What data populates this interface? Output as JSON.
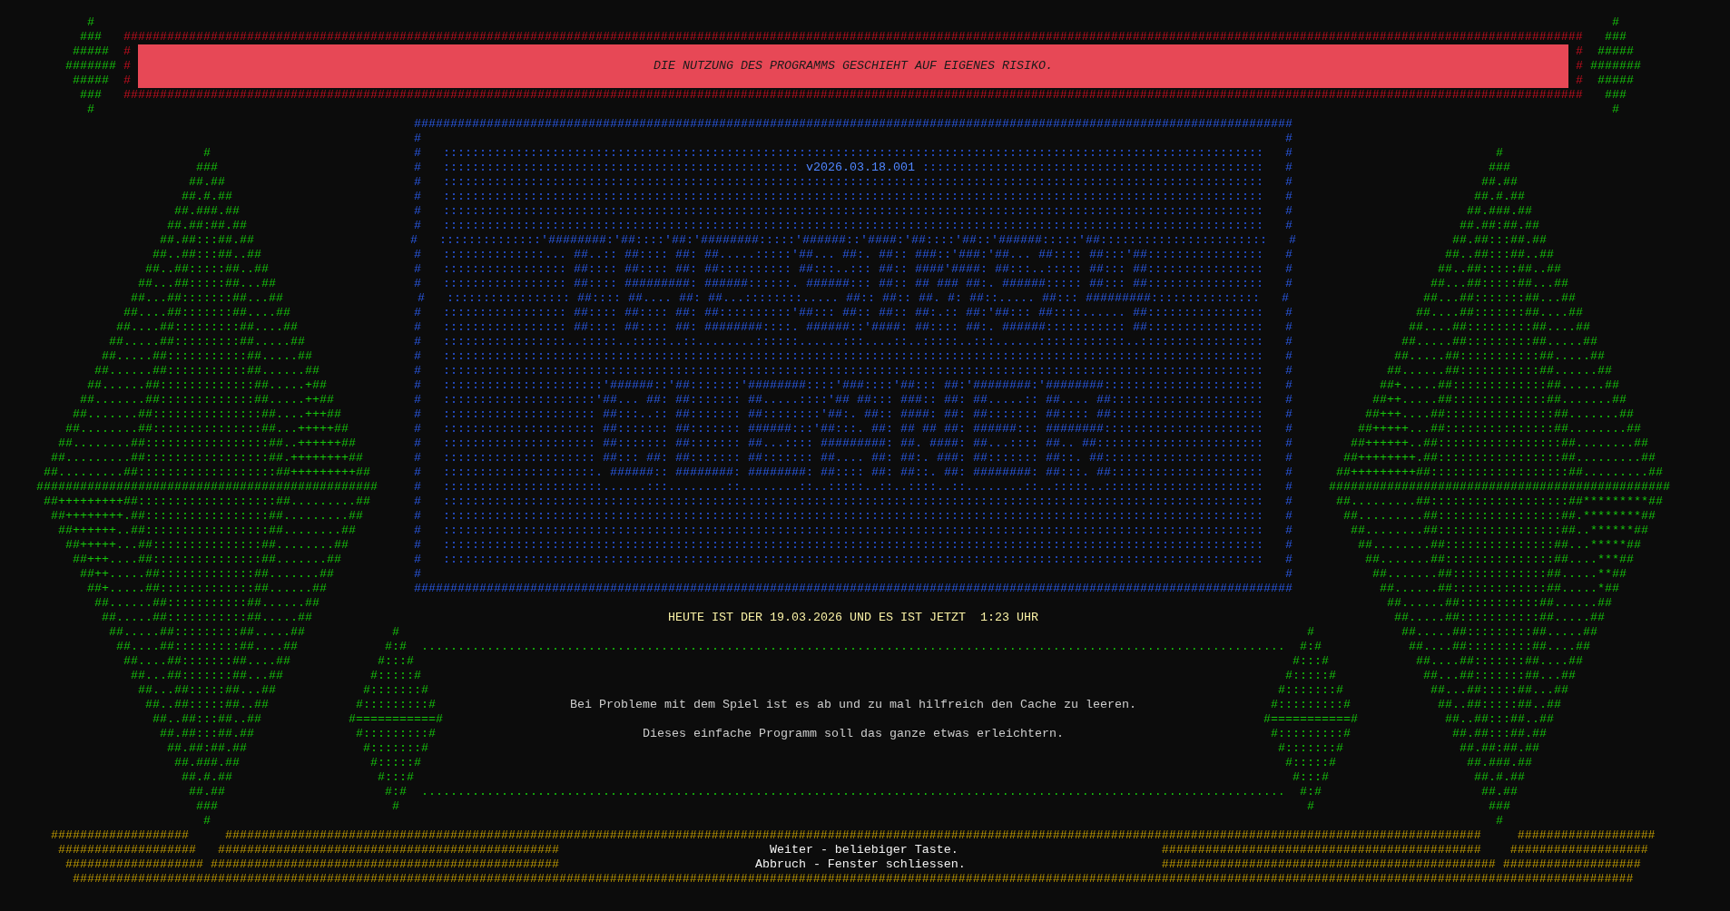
{
  "top_left_diamond": [
    "#",
    "###",
    "#####",
    "#######",
    "#####",
    "###",
    "#"
  ],
  "warning_banner": {
    "top_border": "#########################################################################################################################################################################################################",
    "left_marks": [
      "#",
      "#",
      "#"
    ],
    "message": "DIE NUTZUNG DES PROGRAMMS GESCHIEHT AUF EIGENES RISIKO.",
    "right_marks": [
      "#",
      "#",
      "#"
    ],
    "bottom_border": "#########################################################################################################################################################################################################"
  },
  "top_right_diamond": [
    "#",
    "###",
    "#####",
    "#######",
    "#####",
    "###",
    "#"
  ],
  "left_diamond": [
    "#",
    "###",
    "##.##",
    "##.#.##",
    "##.###.##",
    "##.##:##.##",
    "##.##:::##.##",
    "##..##:::##..##",
    "##..##:::::##..##",
    "##...##:::::##...##",
    "##...##:::::::##...##",
    "##....##:::::::##....##",
    "##....##:::::::::##....##",
    "##.....##:::::::::##.....##",
    "##.....##:::::::::::##.....##",
    "##......##:::::::::::##......##",
    "##......##:::::::::::::##.....+##",
    "##.......##:::::::::::::##.....++##",
    "##.......##:::::::::::::::##....+++##",
    "##........##:::::::::::::::##...+++++##",
    "##........##:::::::::::::::::##..++++++##",
    "##.........##:::::::::::::::::##.++++++++##",
    "##.........##:::::::::::::::::::##+++++++++##",
    "###############################################",
    "##+++++++++##:::::::::::::::::::##.........##",
    "##++++++++.##:::::::::::::::::##.........##",
    "##++++++..##:::::::::::::::::##........##",
    "##+++++...##:::::::::::::::##........##",
    "##+++....##:::::::::::::::##.......##",
    "##++.....##:::::::::::::##.......##",
    "##+.....##:::::::::::::##......##",
    "##......##:::::::::::##......##",
    "##.....##:::::::::::##.....##",
    "##.....##:::::::::##.....##",
    "##....##:::::::::##....##",
    "##....##:::::::##....##",
    "##...##:::::::##...##",
    "##...##:::::##...##",
    "##..##:::::##..##",
    "##..##:::##..##",
    "##.##:::##.##",
    "##.##:##.##",
    "##.###.##",
    "##.#.##",
    "##.##",
    "###",
    "#"
  ],
  "title_box": {
    "rows": [
      {
        "kind": "border",
        "text": "#########################################################################################################################"
      },
      {
        "kind": "plain",
        "text": "#                                                                                                                       #"
      },
      {
        "kind": "plain",
        "text": "#   :::::::::::::::::::::::::::::::::::::::::::::::::::::::::::::::::::::::::::::::::::::::::::::::::::::::::::::::::   #"
      },
      {
        "kind": "version",
        "before": "#   ::::::::::::::::::::::::::::::::::::::::::::::::: ",
        "version": "v2026.03.18.001",
        "after": " :::::::::::::::::::::::::::::::::::::::::::::::   #"
      },
      {
        "kind": "plain",
        "text": "#   :::::::::::::::::::::::::::::::::::::::::::::::::::::::::::::::::::::::::::::::::::::::::::::::::::::::::::::::::   #"
      },
      {
        "kind": "plain",
        "text": "#   :::::::::::::::::::::::::::::::::::::::::::::::::::::::::::::::::::::::::::::::::::::::::::::::::::::::::::::::::   #"
      },
      {
        "kind": "plain",
        "text": "#   :::::::::::::::::::::::::::::::::::::::::::::::::::::::::::::::::::::::::::::::::::::::::::::::::::::::::::::::::   #"
      },
      {
        "kind": "plain",
        "text": "#   :::::::::::::::::::::::::::::::::::::::::::::::::::::::::::::::::::::::::::::::::::::::::::::::::::::::::::::::::   #"
      },
      {
        "kind": "plain",
        "text": "#   ::::::::::::::'########:'##::::'##:'########:::::'######::'####:'##::::'##::'######:::::'##:::::::::::::::::::::::   #"
      },
      {
        "kind": "plain",
        "text": "#   ::::::::::::::... ##..:: ##:::: ##: ##.....:::::'##... ##:. ##:: ###::'###:'##... ##:::: ##:::'##::::::::::::::::   #"
      },
      {
        "kind": "plain",
        "text": "#   ::::::::::::::::: ##:::: ##:::: ##: ##:::::::::: ##:::..::: ##:: ####'####: ##:::..::::: ##::: ##::::::::::::::::   #"
      },
      {
        "kind": "plain",
        "text": "#   ::::::::::::::::: ##:::: #########: ######::::::. ######::: ##:: ## ### ##:. ######::::: ##::: ##::::::::::::::::   #"
      },
      {
        "kind": "plain",
        "text": "#   ::::::::::::::::: ##:::: ##.... ##: ##...::::::::..... ##:: ##:: ##. #: ##::..... ##::: #########:::::::::::::::   #"
      },
      {
        "kind": "plain",
        "text": "#   ::::::::::::::::: ##:::: ##:::: ##: ##::::::::::'##::: ##:: ##:: ##:.:: ##:'##::: ##::::...... ##::::::::::::::::   #"
      },
      {
        "kind": "plain",
        "text": "#   ::::::::::::::::: ##:::: ##:::: ##: ########::::. ######::'####: ##:::: ##:. ######::::::::::: ##::::::::::::::::   #"
      },
      {
        "kind": "plain",
        "text": "#   :::::::::::::::::..:::::..:::::..::........::::::......:::....::..:::::..:::......::::::::::::..:::::::::::::::::   #"
      },
      {
        "kind": "plain",
        "text": "#   :::::::::::::::::::::::::::::::::::::::::::::::::::::::::::::::::::::::::::::::::::::::::::::::::::::::::::::::::   #"
      },
      {
        "kind": "plain",
        "text": "#   :::::::::::::::::::::::::::::::::::::::::::::::::::::::::::::::::::::::::::::::::::::::::::::::::::::::::::::::::   #"
      },
      {
        "kind": "plain",
        "text": "#   ::::::::::::::::::::::'######::'##:::::::'########::::'###::::'##::: ##:'########:'########::::::::::::::::::::::   #"
      },
      {
        "kind": "plain",
        "text": "#   :::::::::::::::::::::'##... ##: ##::::::: ##.....::::'## ##::: ###:: ##: ##.....:: ##.... ##:::::::::::::::::::::   #"
      },
      {
        "kind": "plain",
        "text": "#   ::::::::::::::::::::: ##:::..:: ##::::::: ##::::::::'##:. ##:: ####: ##: ##::::::: ##:::: ##:::::::::::::::::::::   #"
      },
      {
        "kind": "plain",
        "text": "#   ::::::::::::::::::::: ##::::::: ##::::::: ######:::'##:::. ##: ## ## ##: ######::: ########::::::::::::::::::::::   #"
      },
      {
        "kind": "plain",
        "text": "#   ::::::::::::::::::::: ##::::::: ##::::::: ##...:::: #########: ##. ####: ##...:::: ##.. ##:::::::::::::::::::::::   #"
      },
      {
        "kind": "plain",
        "text": "#   ::::::::::::::::::::: ##::: ##: ##::::::: ##::::::: ##.... ##: ##:. ###: ##::::::: ##::. ##::::::::::::::::::::::   #"
      },
      {
        "kind": "plain",
        "text": "#   :::::::::::::::::::::. ######:: ########: ########: ##:::: ##: ##::. ##: ########: ##:::. ##:::::::::::::::::::::   #"
      },
      {
        "kind": "plain",
        "text": "#   ::::::::::::::::::::::......:::........::........::..:::::..::..::::..::........::..:::::..::::::::::::::::::::::   #"
      },
      {
        "kind": "plain",
        "text": "#   :::::::::::::::::::::::::::::::::::::::::::::::::::::::::::::::::::::::::::::::::::::::::::::::::::::::::::::::::   #"
      },
      {
        "kind": "plain",
        "text": "#   :::::::::::::::::::::::::::::::::::::::::::::::::::::::::::::::::::::::::::::::::::::::::::::::::::::::::::::::::   #"
      },
      {
        "kind": "plain",
        "text": "#   :::::::::::::::::::::::::::::::::::::::::::::::::::::::::::::::::::::::::::::::::::::::::::::::::::::::::::::::::   #"
      },
      {
        "kind": "plain",
        "text": "#   :::::::::::::::::::::::::::::::::::::::::::::::::::::::::::::::::::::::::::::::::::::::::::::::::::::::::::::::::   #"
      },
      {
        "kind": "plain",
        "text": "#   :::::::::::::::::::::::::::::::::::::::::::::::::::::::::::::::::::::::::::::::::::::::::::::::::::::::::::::::::   #"
      },
      {
        "kind": "plain",
        "text": "#                                                                                                                       #"
      },
      {
        "kind": "border",
        "text": "#########################################################################################################################"
      }
    ]
  },
  "right_diamond": [
    "#",
    "###",
    "##.##",
    "##.#.##",
    "##.###.##",
    "##.##:##.##",
    "##.##:::##.##",
    "##..##:::##..##",
    "##..##:::::##..##",
    "##...##:::::##...##",
    "##...##:::::::##...##",
    "##....##:::::::##....##",
    "##....##:::::::::##....##",
    "##.....##:::::::::##.....##",
    "##.....##:::::::::::##.....##",
    "##......##:::::::::::##......##",
    "##+.....##:::::::::::::##......##",
    "##++.....##:::::::::::::##.......##",
    "##+++....##:::::::::::::::##.......##",
    "##+++++...##:::::::::::::::##........##",
    "##++++++..##:::::::::::::::::##........##",
    "##++++++++.##:::::::::::::::::##.........##",
    "##+++++++++##:::::::::::::::::::##.........##",
    "###############################################",
    "##.........##:::::::::::::::::::##*********##",
    "##.........##:::::::::::::::::##.********##",
    "##........##:::::::::::::::::##..******##",
    "##........##:::::::::::::::##...*****##",
    "##.......##:::::::::::::::##....***##",
    "##.......##:::::::::::::##.....**##",
    "##......##:::::::::::::##.....*##",
    "##......##:::::::::::##......##",
    "##.....##:::::::::::##.....##",
    "##.....##:::::::::##.....##",
    "##....##:::::::::##....##",
    "##....##:::::::##....##",
    "##...##:::::::##...##",
    "##...##:::::##...##",
    "##..##:::::##..##",
    "##..##:::##..##",
    "##.##:::##.##",
    "##.##:##.##",
    "##.###.##",
    "##.#.##",
    "##.##",
    "###",
    "#"
  ],
  "date_line": "HEUTE IST DER 19.03.2026 UND ES IST JETZT  1:23 UHR",
  "info_frame": {
    "left_diamond": [
      "#",
      "#:#",
      "#:::#",
      "#:::::#",
      "#:::::::#",
      "#:::::::::#",
      "#===========#",
      "#:::::::::#",
      "#:::::::#",
      "#:::::#",
      "#:::#",
      "#:#",
      "#"
    ],
    "top_dots": ".......................................................................................................................",
    "messages": [
      "Bei Probleme mit dem Spiel ist es ab und zu mal hilfreich den Cache zu leeren.",
      "Dieses einfache Programm soll das ganze etwas erleichtern."
    ],
    "bottom_dots": ".......................................................................................................................",
    "right_diamond": [
      "#",
      "#:#",
      "#:::#",
      "#:::::#",
      "#:::::::#",
      "#:::::::::#",
      "#===========#",
      "#:::::::::#",
      "#:::::::#",
      "#:::::#",
      "#:::#",
      "#:#",
      "#"
    ]
  },
  "footer_rows": [
    {
      "segments": [
        {
          "kind": "hash",
          "text": "###################"
        },
        {
          "kind": "hash",
          "text": "#############################################################################################################################################################################"
        },
        {
          "kind": "hash",
          "text": "###################"
        }
      ]
    },
    {
      "segments": [
        {
          "kind": "hash",
          "text": "###################"
        },
        {
          "kind": "hash",
          "text": "###############################################"
        },
        {
          "kind": "label",
          "text": "Weiter - beliebiger Taste."
        },
        {
          "kind": "hash",
          "text": "############################################"
        },
        {
          "kind": "hash",
          "text": "###################"
        }
      ]
    },
    {
      "segments": [
        {
          "kind": "hash",
          "text": "###################"
        },
        {
          "kind": "hash",
          "text": "################################################"
        },
        {
          "kind": "label",
          "text": "Abbruch - Fenster schliessen."
        },
        {
          "kind": "hash",
          "text": "##############################################"
        },
        {
          "kind": "hash",
          "text": "###################"
        }
      ]
    },
    {
      "segments": [
        {
          "kind": "hash",
          "text": "#######################################################################################################################################################################################################################"
        }
      ]
    }
  ]
}
